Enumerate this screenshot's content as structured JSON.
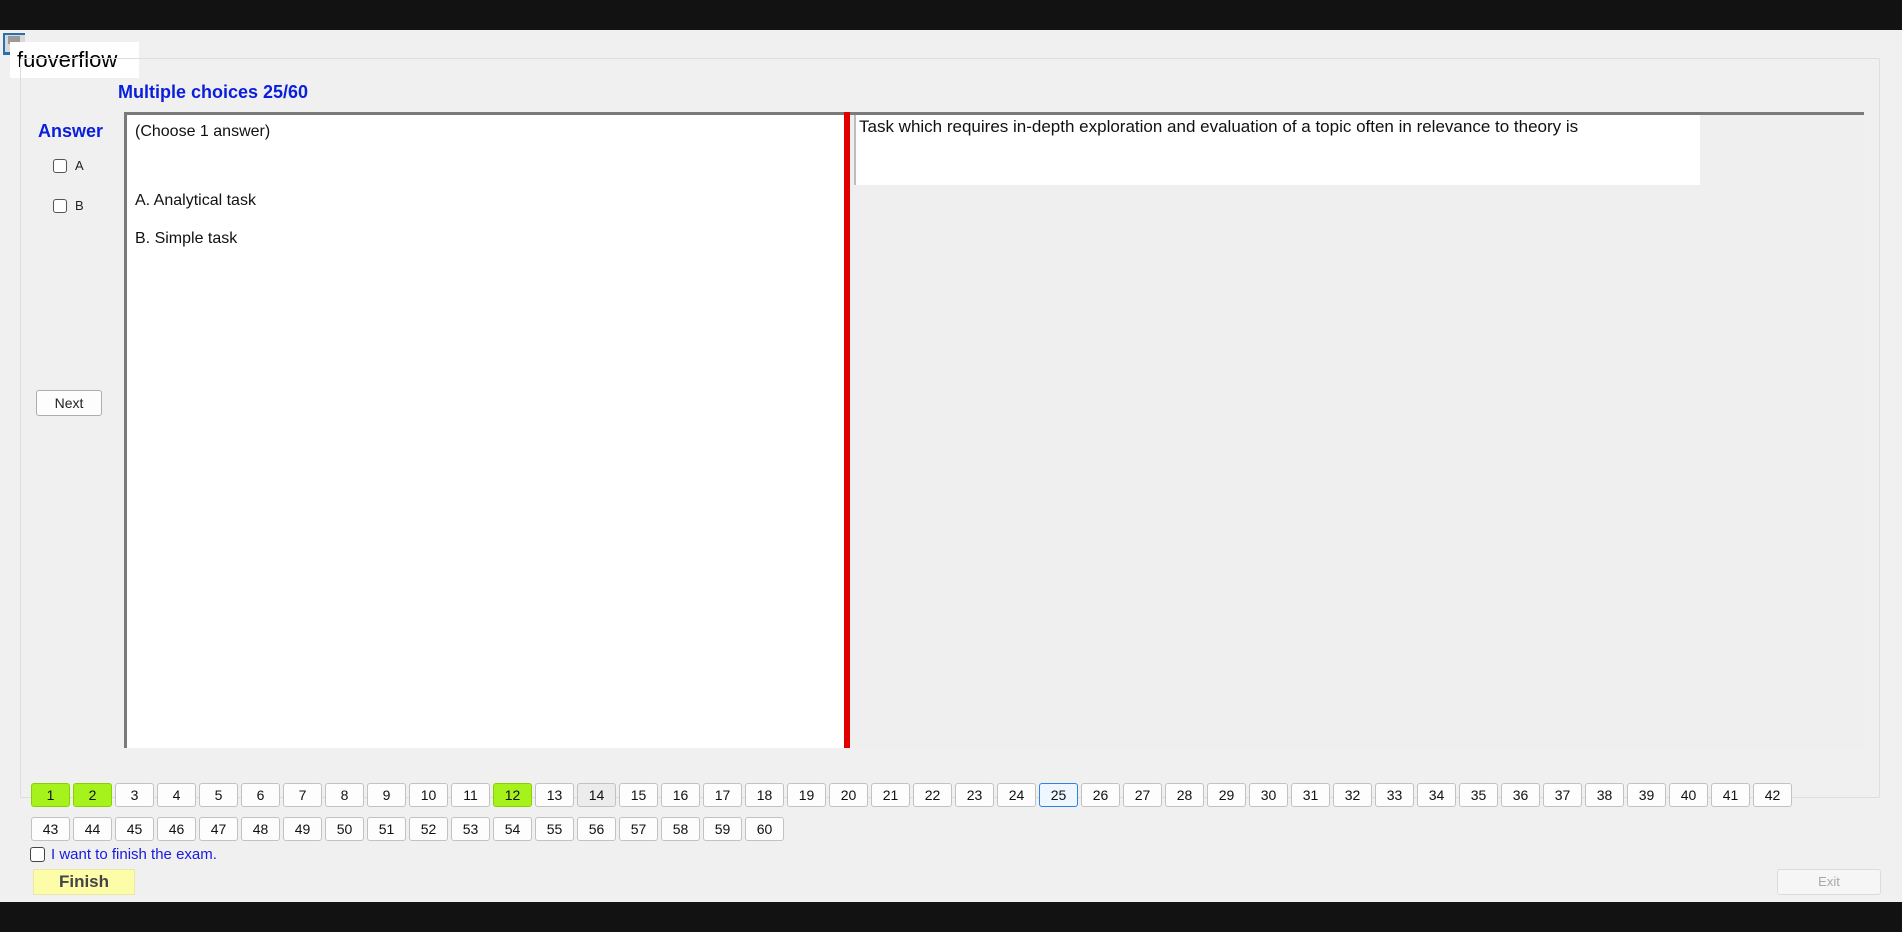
{
  "watermark": "fuoverflow",
  "section_title": "Multiple choices 25/60",
  "answer_label": "Answer",
  "answer_checkboxes": [
    "A",
    "B"
  ],
  "next_label": "Next",
  "choose_hint": "(Choose 1 answer)",
  "answers": [
    "A.  Analytical task",
    "B.  Simple task"
  ],
  "question": "Task which requires in-depth exploration and evaluation of a topic often in relevance to theory is",
  "question_nav": {
    "row1": [
      "1",
      "2",
      "3",
      "4",
      "5",
      "6",
      "7",
      "8",
      "9",
      "10",
      "11",
      "12",
      "13",
      "14",
      "15",
      "16",
      "17",
      "18",
      "19",
      "20",
      "21",
      "22",
      "23",
      "24",
      "25",
      "26",
      "27",
      "28",
      "29",
      "30",
      "31",
      "32",
      "33",
      "34",
      "35",
      "36",
      "37",
      "38",
      "39",
      "40",
      "41",
      "42"
    ],
    "row2": [
      "43",
      "44",
      "45",
      "46",
      "47",
      "48",
      "49",
      "50",
      "51",
      "52",
      "53",
      "54",
      "55",
      "56",
      "57",
      "58",
      "59",
      "60"
    ],
    "answered": [
      "1",
      "2",
      "12"
    ],
    "visited": [
      "14"
    ],
    "current": "25"
  },
  "finish_check_label": "I want to finish the exam.",
  "finish_label": "Finish",
  "exit_label": "Exit",
  "colors": {
    "answered": "#a6f21c",
    "current_border": "#2d83e0",
    "splitter": "#e10000",
    "title_blue": "#0a1edc",
    "finish_bg": "#fdfca8"
  }
}
